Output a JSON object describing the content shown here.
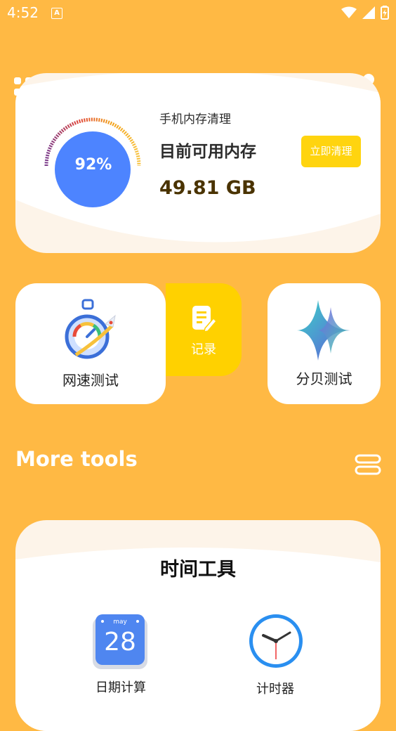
{
  "status_bar": {
    "time": "4:52",
    "notification_icon": "A"
  },
  "memory": {
    "title": "手机内存清理",
    "subtitle": "目前可用内存",
    "value": "49.81 GB",
    "percent": "92%",
    "clean_button": "立即清理"
  },
  "tools": {
    "speed_test": {
      "label": "网速测试",
      "icon": "speedometer-rocket-icon"
    },
    "record": {
      "label": "记录",
      "icon": "note-edit-icon"
    },
    "decibel": {
      "label": "分贝测试",
      "icon": "soundwave-icon"
    }
  },
  "more_tools": {
    "title": "More tools"
  },
  "time_tools": {
    "title": "时间工具",
    "calendar": {
      "label": "日期计算",
      "month": "may",
      "day": "28"
    },
    "timer": {
      "label": "计时器"
    }
  },
  "colors": {
    "background": "#FFB944",
    "accent_yellow": "#FFD100",
    "gauge_blue": "#4D84FF"
  }
}
